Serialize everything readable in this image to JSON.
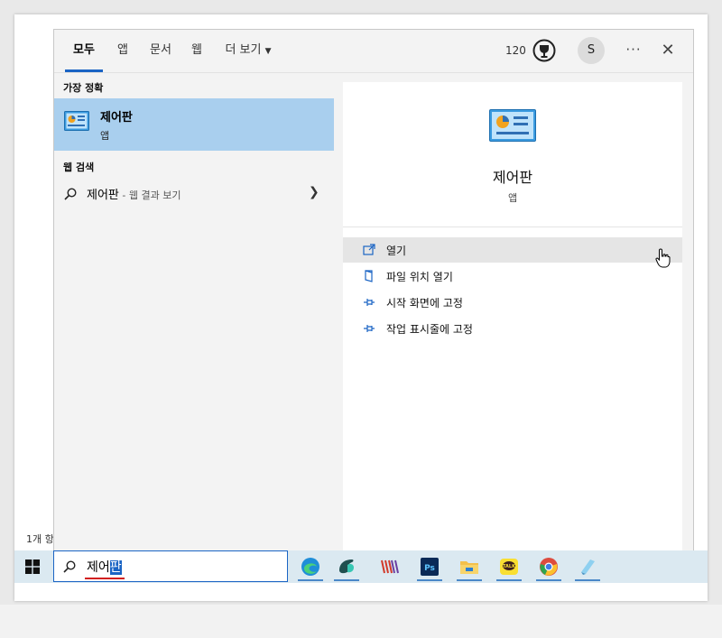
{
  "tabs": [
    "모두",
    "앱",
    "문서",
    "웹",
    "더 보기"
  ],
  "header": {
    "points": "120",
    "avatar_letter": "S",
    "more_label": "···",
    "close_label": "✕"
  },
  "behind_status": "1개 항",
  "left_pane": {
    "best_match_title": "가장 정확",
    "best_match": {
      "name": "제어판",
      "type": "앱"
    },
    "web_search_title": "웹 검색",
    "web_item": {
      "query": "제어판",
      "suffix": " - 웹 결과 보기"
    }
  },
  "right_pane": {
    "name": "제어판",
    "type": "앱",
    "actions": [
      "열기",
      "파일 위치 열기",
      "시작 화면에 고정",
      "작업 표시줄에 고정"
    ]
  },
  "taskbar": {
    "search_text": "제어",
    "search_text_selected": "판",
    "apps": [
      "edge-icon",
      "app-icon",
      "notes-icon",
      "photoshop-icon",
      "file-explorer-icon",
      "kakaotalk-icon",
      "chrome-icon",
      "app2-icon"
    ]
  },
  "colors": {
    "accent": "#1a64c4",
    "highlight": "#a9cfee",
    "taskbar": "#dbe9f1"
  }
}
